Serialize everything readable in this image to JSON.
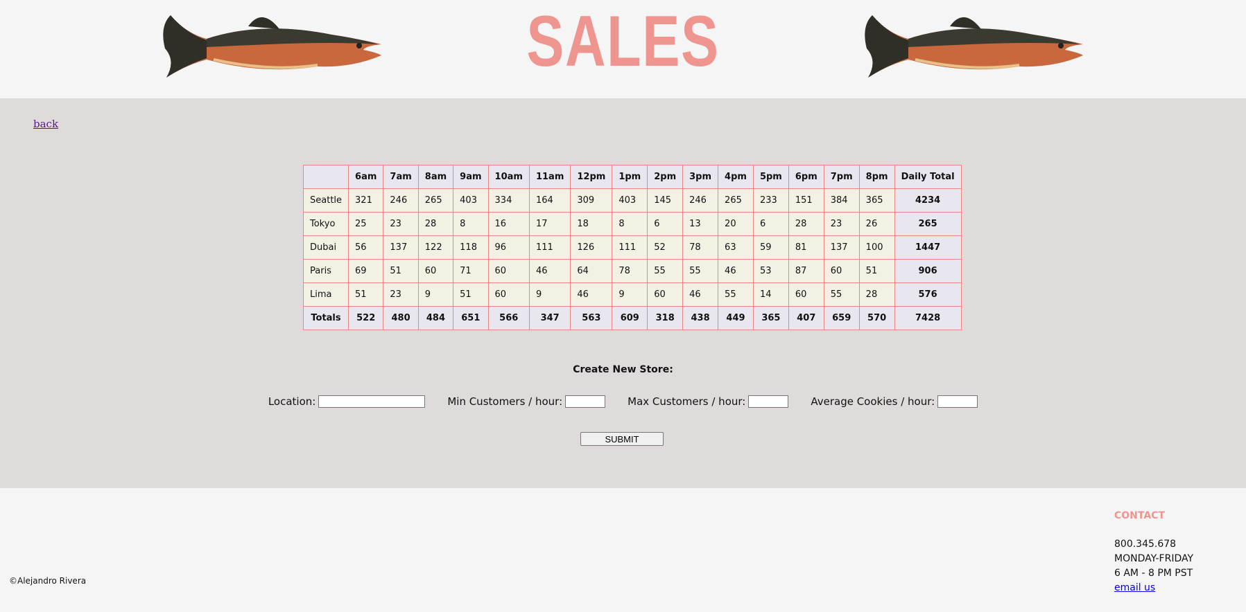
{
  "header": {
    "title": "SALES"
  },
  "nav": {
    "back_label": "back"
  },
  "table": {
    "headers": [
      "",
      "6am",
      "7am",
      "8am",
      "9am",
      "10am",
      "11am",
      "12pm",
      "1pm",
      "2pm",
      "3pm",
      "4pm",
      "5pm",
      "6pm",
      "7pm",
      "8pm",
      "Daily Total"
    ],
    "rows": [
      {
        "store": "Seattle",
        "values": [
          "321",
          "246",
          "265",
          "403",
          "334",
          "164",
          "309",
          "403",
          "145",
          "246",
          "265",
          "233",
          "151",
          "384",
          "365"
        ],
        "total": "4234"
      },
      {
        "store": "Tokyo",
        "values": [
          "25",
          "23",
          "28",
          "8",
          "16",
          "17",
          "18",
          "8",
          "6",
          "13",
          "20",
          "6",
          "28",
          "23",
          "26"
        ],
        "total": "265"
      },
      {
        "store": "Dubai",
        "values": [
          "56",
          "137",
          "122",
          "118",
          "96",
          "111",
          "126",
          "111",
          "52",
          "78",
          "63",
          "59",
          "81",
          "137",
          "100"
        ],
        "total": "1447"
      },
      {
        "store": "Paris",
        "values": [
          "69",
          "51",
          "60",
          "71",
          "60",
          "46",
          "64",
          "78",
          "55",
          "55",
          "46",
          "53",
          "87",
          "60",
          "51"
        ],
        "total": "906"
      },
      {
        "store": "Lima",
        "values": [
          "51",
          "23",
          "9",
          "51",
          "60",
          "9",
          "46",
          "9",
          "60",
          "46",
          "55",
          "14",
          "60",
          "55",
          "28"
        ],
        "total": "576"
      }
    ],
    "totals": {
      "label": "Totals",
      "values": [
        "522",
        "480",
        "484",
        "651",
        "566",
        "347",
        "563",
        "609",
        "318",
        "438",
        "449",
        "365",
        "407",
        "659",
        "570"
      ],
      "grand_total": "7428"
    }
  },
  "form": {
    "title": "Create New Store:",
    "location_label": "Location:",
    "min_label": "Min Customers / hour:",
    "max_label": "Max Customers / hour:",
    "avg_label": "Average Cookies / hour:",
    "location_value": "",
    "min_value": "",
    "max_value": "",
    "avg_value": "",
    "submit_label": "SUBMIT"
  },
  "footer": {
    "copyright": "©Alejandro Rivera",
    "contact_title": "CONTACT",
    "phone": "800.345.678",
    "days": "MONDAY-FRIDAY",
    "hours": "6 AM - 8 PM PST",
    "email_label": "email us"
  },
  "colors": {
    "accent": "#ef958f",
    "table_border": "#e8867f",
    "main_bg": "#dfdbdb",
    "page_bg": "#f5f5f5"
  },
  "icons": {
    "fish_image": "salmon-image"
  }
}
